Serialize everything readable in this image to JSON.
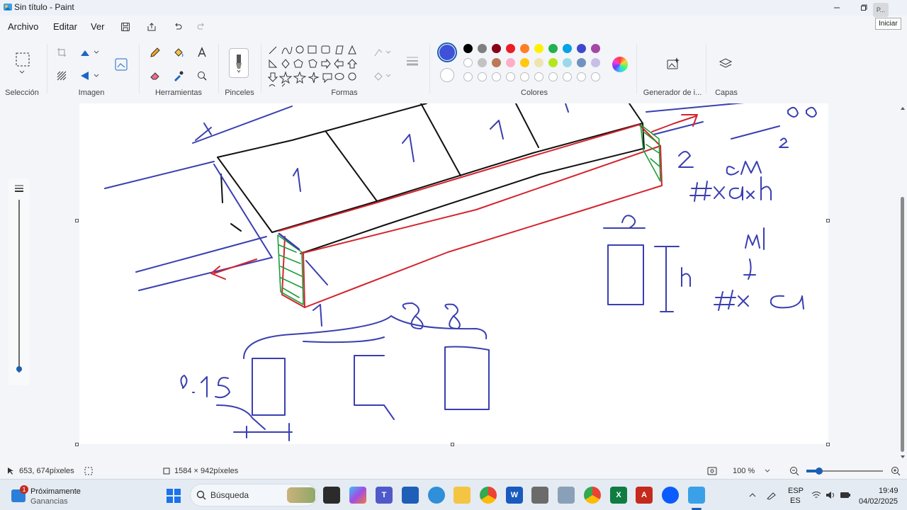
{
  "window": {
    "title": "Sin título - Paint",
    "tooltip": "Iniciar",
    "profile_label": "P..."
  },
  "menu": {
    "file": "Archivo",
    "edit": "Editar",
    "view": "Ver"
  },
  "ribbon": {
    "groups": {
      "selection": "Selección",
      "image": "Imagen",
      "tools": "Herramientas",
      "brushes": "Pinceles",
      "shapes": "Formas",
      "colors": "Colores",
      "generator": "Generador de i...",
      "layers": "Capas"
    },
    "primary_color": "#3f51d6",
    "palette_row1": [
      "#000000",
      "#7f7f7f",
      "#880015",
      "#ed1c24",
      "#ff7f27",
      "#fff200",
      "#22b14c",
      "#00a2e8",
      "#3f48cc",
      "#a349a4"
    ],
    "palette_row2": [
      "#ffffff",
      "#c3c3c3",
      "#b97a57",
      "#ffaec9",
      "#ffc90e",
      "#efe4b0",
      "#b5e61d",
      "#99d9ea",
      "#7092be",
      "#c8bfe7"
    ]
  },
  "status": {
    "cursor_position": "653, 674píxeles",
    "canvas_size": "1584 × 942píxeles",
    "zoom": "100 %"
  },
  "taskbar": {
    "weather_title": "Próximamente",
    "weather_sub": "Ganancias",
    "weather_badge": "1",
    "search_placeholder": "Búsqueda",
    "lang_top": "ESP",
    "lang_bottom": "ES",
    "time": "19:49",
    "date": "04/02/2025"
  },
  "drawing": {
    "labels": [
      "1",
      "1",
      "1",
      "1",
      "1",
      "2",
      "2 cm",
      "#x a x h",
      "#x a",
      "m",
      "h",
      "8 8",
      "0.15",
      "88",
      "a"
    ]
  }
}
